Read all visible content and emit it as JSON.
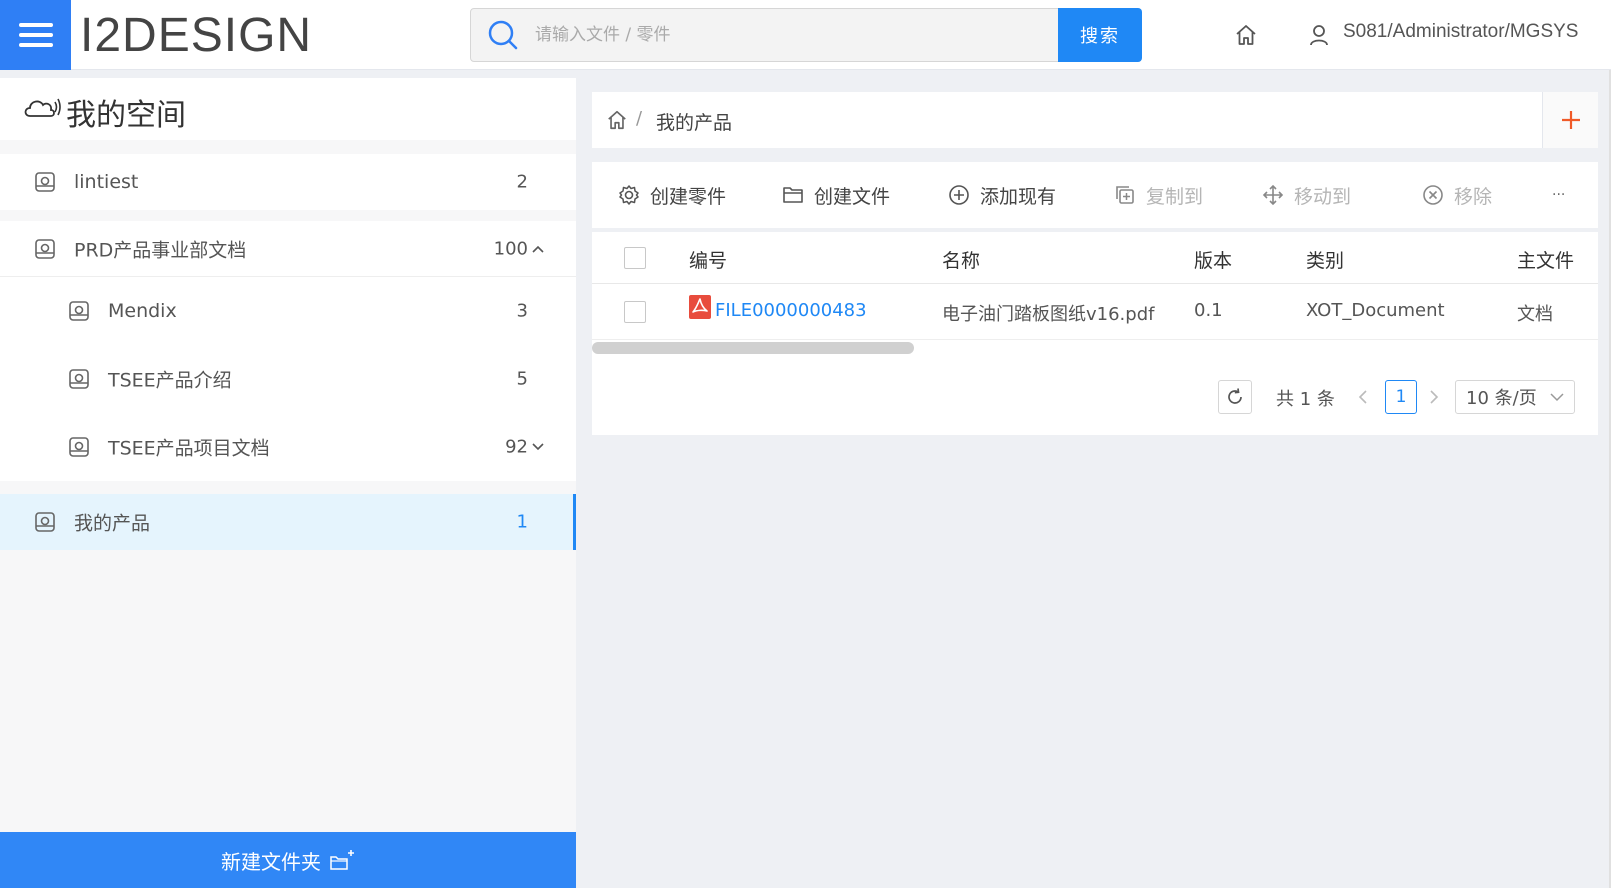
{
  "header": {
    "logo": "I2DESIGN",
    "search_placeholder": "请输入文件 / 零件",
    "search_button": "搜索",
    "user": "S081/Administrator/MGSYS"
  },
  "sidebar": {
    "title": "我的空间",
    "items": [
      {
        "label": "lintiest",
        "count": "2"
      },
      {
        "label": "PRD产品事业部文档",
        "count": "100"
      },
      {
        "label": "Mendix",
        "count": "3"
      },
      {
        "label": "TSEE产品介绍",
        "count": "5"
      },
      {
        "label": "TSEE产品项目文档",
        "count": "92"
      },
      {
        "label": "我的产品",
        "count": "1"
      }
    ],
    "new_folder": "新建文件夹"
  },
  "breadcrumb": {
    "separator": "/",
    "current": "我的产品"
  },
  "toolbar": {
    "create_part": "创建零件",
    "create_file": "创建文件",
    "add_existing": "添加现有",
    "copy_to": "复制到",
    "move_to": "移动到",
    "remove": "移除",
    "more": "···"
  },
  "table": {
    "columns": [
      "编号",
      "名称",
      "版本",
      "类别",
      "主文件"
    ],
    "rows": [
      {
        "number": "FILE0000000483",
        "name": "电子油门踏板图纸v16.pdf",
        "version": "0.1",
        "category": "XOT_Document",
        "main_file": "文档"
      }
    ]
  },
  "pagination": {
    "total": "共 1 条",
    "current_page": "1",
    "page_size": "10 条/页"
  },
  "colors": {
    "primary": "#1f88f5",
    "menu": "#2f7ff5",
    "add": "#f05a28",
    "pdf": "#e84c3d"
  }
}
